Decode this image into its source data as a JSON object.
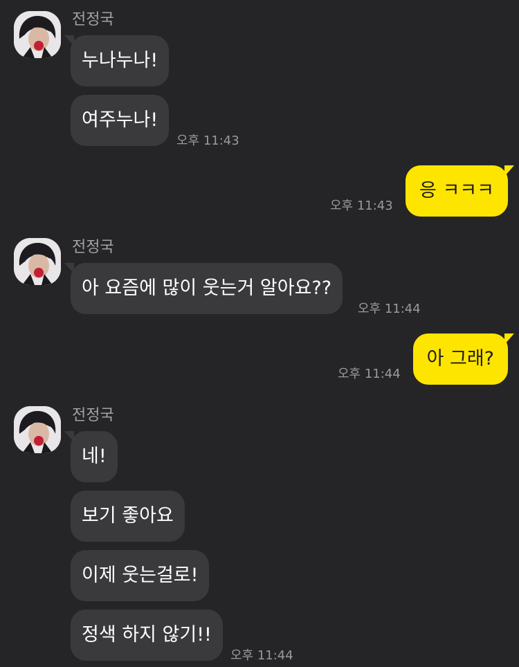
{
  "sender_name": "전정국",
  "messages": {
    "m1": "누나누나!",
    "m2": "여주누나!",
    "m3": "응 ㅋㅋㅋ",
    "m4": "아 요즘에 많이 웃는거 알아요??",
    "m5": "아 그래?",
    "m6": "네!",
    "m7": "보기 좋아요",
    "m8": "이제 웃는걸로!",
    "m9": "정색 하지 않기!!"
  },
  "timestamps": {
    "t1": "오후 11:43",
    "t2": "오후 11:43",
    "t3": "오후 11:44",
    "t4": "오후 11:44",
    "t5": "오후 11:44"
  },
  "colors": {
    "background": "#252527",
    "incoming_bubble": "#3a3a3c",
    "outgoing_bubble": "#fee500"
  },
  "icons": {
    "avatar": "profile-photo"
  }
}
